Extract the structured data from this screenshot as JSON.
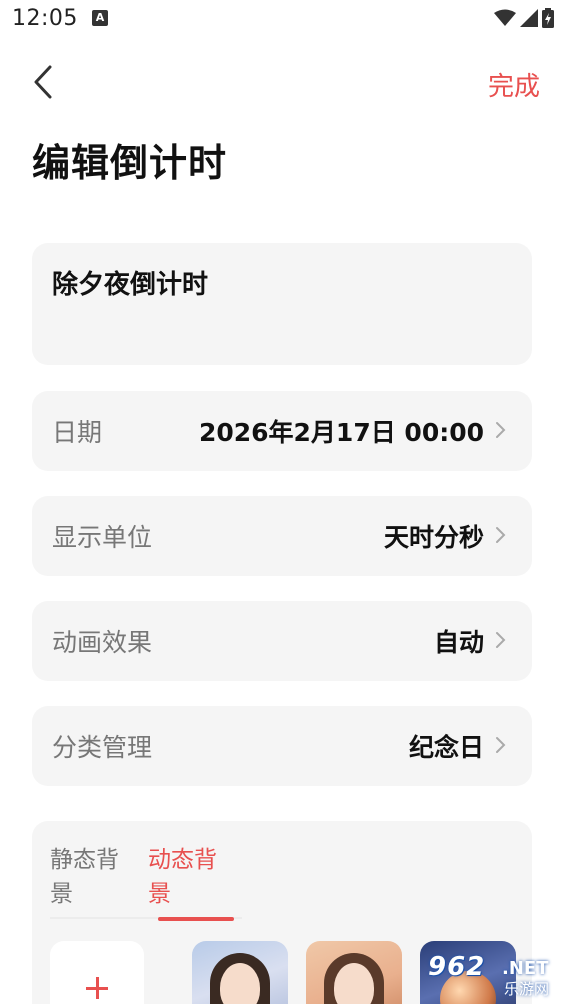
{
  "status_bar": {
    "time": "12:05",
    "notification_icon": "a-notification-icon"
  },
  "header": {
    "back_icon": "chevron-left-icon",
    "done_label": "完成",
    "title": "编辑倒计时"
  },
  "name": {
    "value": "除夕夜倒计时"
  },
  "rows": [
    {
      "label": "日期",
      "value": "2026年2月17日 00:00"
    },
    {
      "label": "显示单位",
      "value": "天时分秒"
    },
    {
      "label": "动画效果",
      "value": "自动"
    },
    {
      "label": "分类管理",
      "value": "纪念日"
    }
  ],
  "background": {
    "tabs": [
      {
        "label": "静态背景",
        "active": false
      },
      {
        "label": "动态背景",
        "active": true
      }
    ],
    "add_icon": "plus-icon",
    "thumbnails": [
      "girl-portrait-1",
      "girl-portrait-2",
      "planet-scene"
    ]
  },
  "watermark": {
    "number": "962",
    "suffix": ".NET",
    "text": "乐游网"
  },
  "colors": {
    "accent": "#e8504f",
    "card": "#f5f5f5",
    "label": "#777777",
    "text": "#111111"
  }
}
